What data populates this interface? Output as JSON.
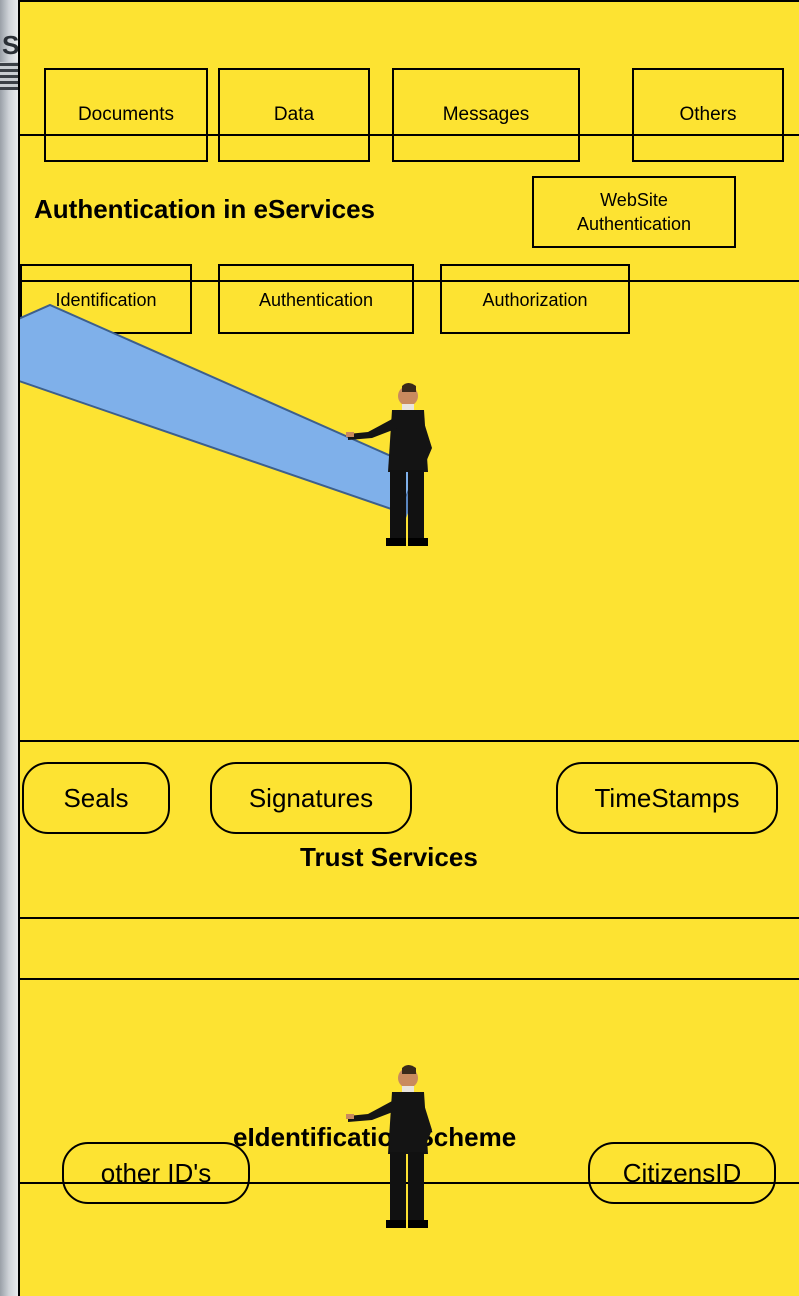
{
  "top_boxes": [
    "Documents",
    "Data",
    "Messages",
    "Others"
  ],
  "authentication_section": {
    "title": "Authentication in eServices",
    "website_box": "WebSite\nAuthentication",
    "steps": [
      "Identification",
      "Authentication",
      "Authorization"
    ]
  },
  "trust_section": {
    "title": "Trust Services",
    "items": [
      "Seals",
      "Signatures",
      "TimeStamps"
    ]
  },
  "eid_section": {
    "title": "eIdentification Scheme",
    "left_item": "other ID's",
    "right_item": "CitizensID"
  },
  "colors": {
    "background": "#fde332",
    "beam": "#7fb0ea",
    "border": "#000000"
  }
}
